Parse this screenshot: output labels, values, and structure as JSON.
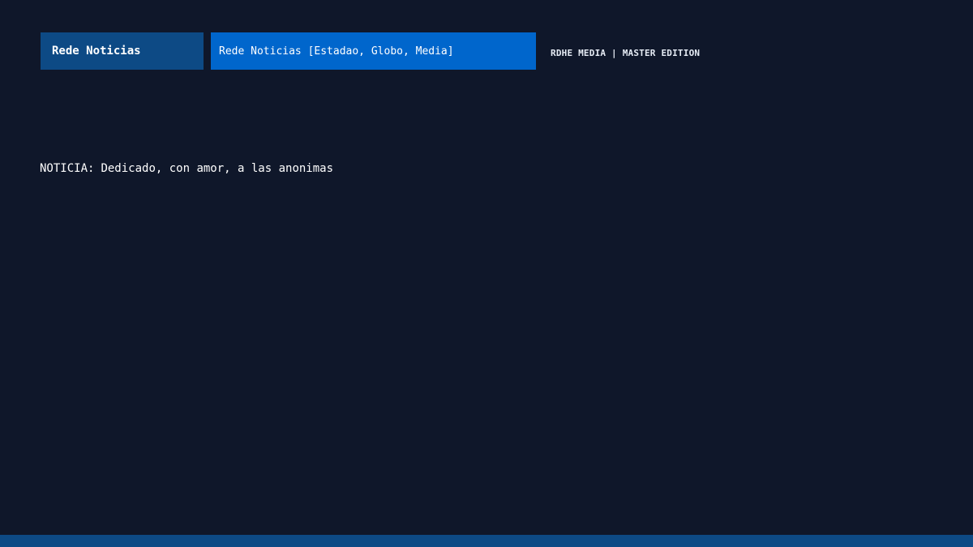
{
  "header": {
    "channel_label": "Rede Noticias",
    "sources_label": "Rede Noticias [Estadao, Globo, Media]",
    "edition_label": "RDHE MEDIA | MASTER EDITION"
  },
  "news": {
    "prefix": "NOTICIA:",
    "text": "Dedicado, con amor, a las anonimas"
  },
  "colors": {
    "background": "#0f172a",
    "channel_button": "#0d4a85",
    "sources_field": "#0066cc",
    "bottom_bar": "#0d4a85"
  }
}
